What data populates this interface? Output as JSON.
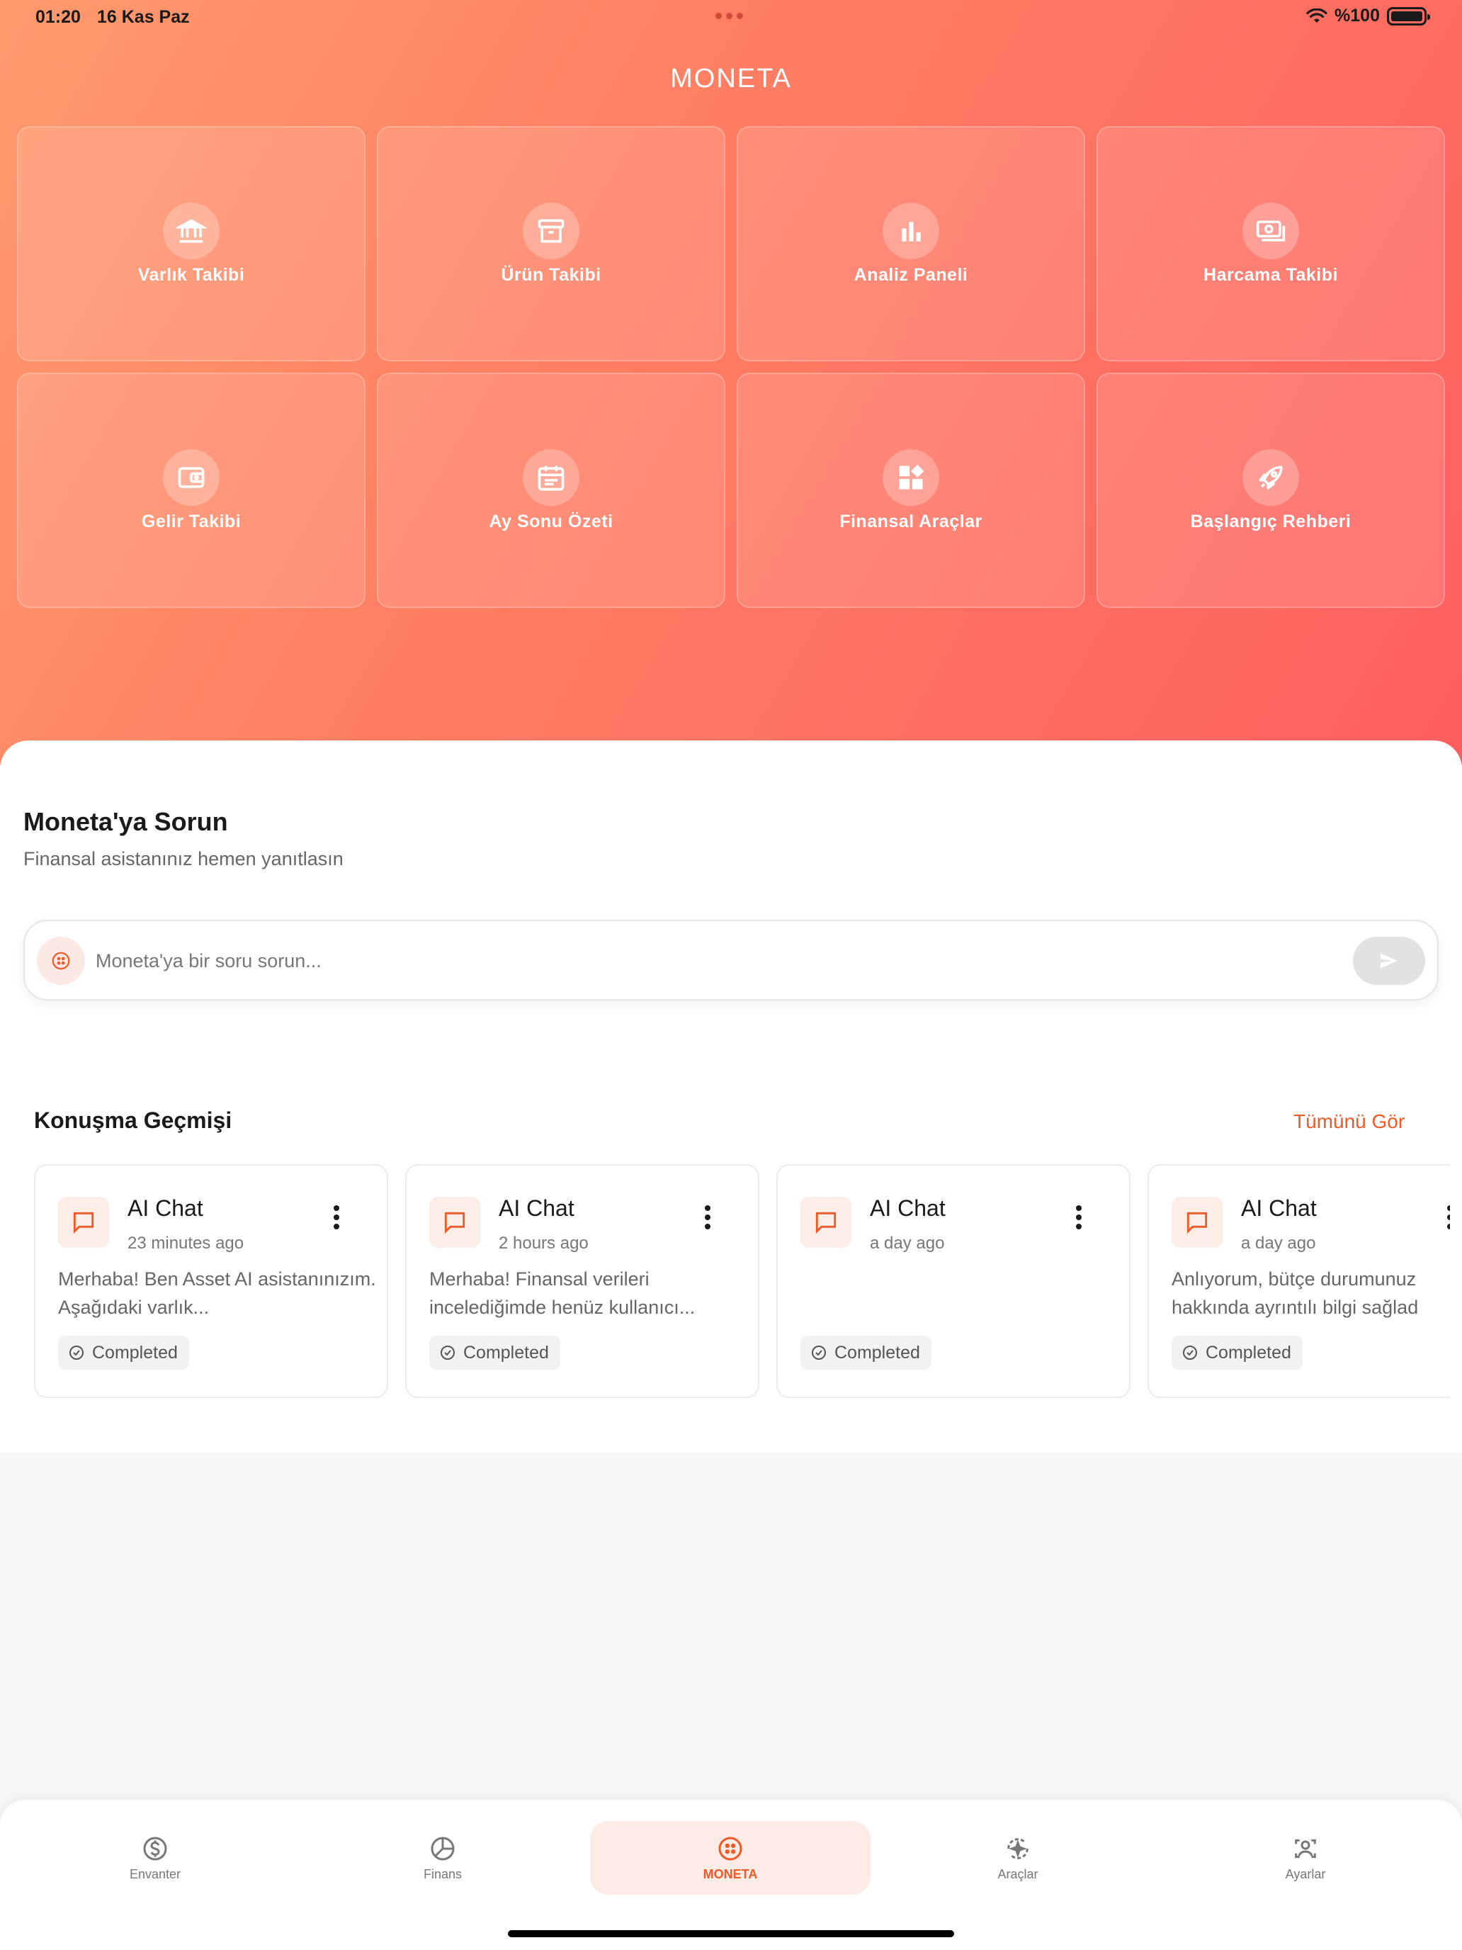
{
  "status_bar": {
    "time": "01:20",
    "date": "16 Kas Paz",
    "battery": "%100"
  },
  "app": {
    "title": "MONETA"
  },
  "tiles": [
    {
      "label": "Varlık Takibi",
      "icon": "bank-icon"
    },
    {
      "label": "Ürün Takibi",
      "icon": "archive-icon"
    },
    {
      "label": "Analiz Paneli",
      "icon": "bar-chart-icon"
    },
    {
      "label": "Harcama Takibi",
      "icon": "cash-icon"
    },
    {
      "label": "Gelir Takibi",
      "icon": "wallet-icon"
    },
    {
      "label": "Ay Sonu Özeti",
      "icon": "calendar-icon"
    },
    {
      "label": "Finansal Araçlar",
      "icon": "widgets-icon"
    },
    {
      "label": "Başlangıç Rehberi",
      "icon": "rocket-icon"
    }
  ],
  "ask": {
    "title": "Moneta'ya Sorun",
    "subtitle": "Finansal asistanınız hemen yanıtlasın",
    "placeholder": "Moneta'ya bir soru sorun..."
  },
  "history": {
    "title": "Konuşma Geçmişi",
    "see_all": "Tümünü Gör",
    "items": [
      {
        "title": "AI Chat",
        "time": "23 minutes ago",
        "preview": "Merhaba! Ben Asset AI asistanınızım. Aşağıdaki varlık...",
        "status": "Completed"
      },
      {
        "title": "AI Chat",
        "time": "2 hours ago",
        "preview": "Merhaba! Finansal verileri incelediğimde henüz kullanıcı...",
        "status": "Completed"
      },
      {
        "title": "AI Chat",
        "time": "a day ago",
        "preview": "",
        "status": "Completed"
      },
      {
        "title": "AI Chat",
        "time": "a day ago",
        "preview": "Anlıyorum, bütçe durumunuz hakkında ayrıntılı bilgi sağlad",
        "status": "Completed"
      }
    ]
  },
  "tabbar": {
    "items": [
      {
        "label": "Envanter",
        "icon": "dollar-circle-icon"
      },
      {
        "label": "Finans",
        "icon": "pie-chart-icon"
      },
      {
        "label": "MONETA",
        "icon": "moneta-icon",
        "active": true
      },
      {
        "label": "Araçlar",
        "icon": "sparkle-tools-icon"
      },
      {
        "label": "Ayarlar",
        "icon": "user-settings-icon"
      }
    ]
  },
  "colors": {
    "accent": "#f05a28",
    "hero_start": "#ff9a6e",
    "hero_end": "#ff5f5f"
  }
}
